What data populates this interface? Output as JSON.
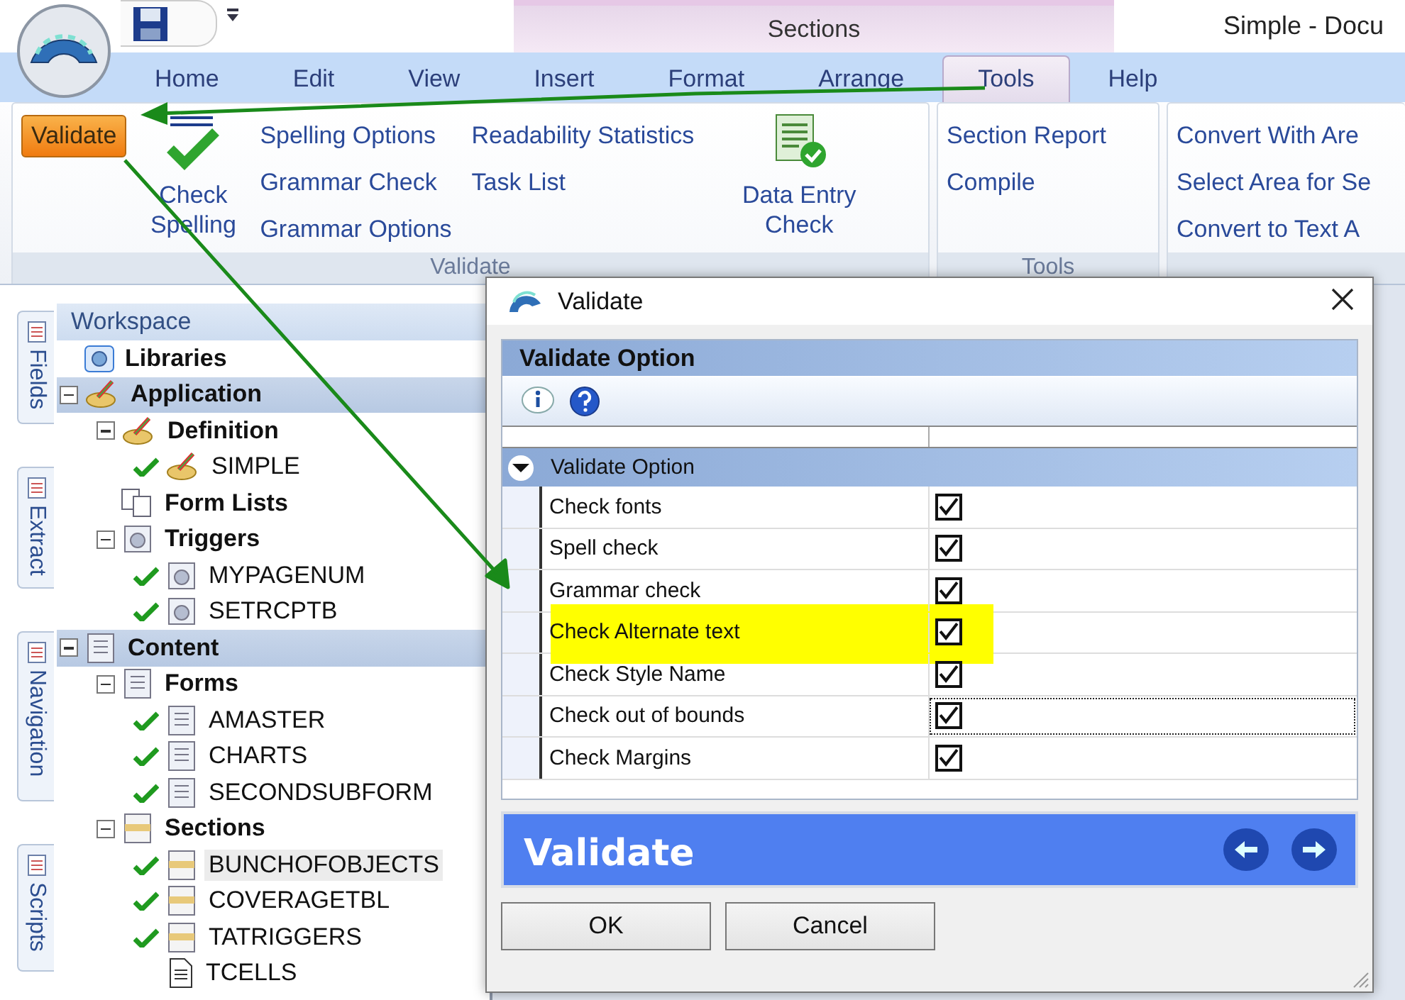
{
  "app": {
    "title": "Simple - Docu",
    "context_group": "Sections"
  },
  "ribbon_tabs": [
    {
      "label": "Home",
      "selected": false
    },
    {
      "label": "Edit",
      "selected": false
    },
    {
      "label": "View",
      "selected": false
    },
    {
      "label": "Insert",
      "selected": false
    },
    {
      "label": "Format",
      "selected": false
    },
    {
      "label": "Arrange",
      "selected": false
    },
    {
      "label": "Tools",
      "selected": true
    },
    {
      "label": "Help",
      "selected": false
    }
  ],
  "ribbon": {
    "validate_group": {
      "label": "Validate",
      "validate_button": {
        "label": "Validate",
        "highlighted": true
      },
      "check_spelling": "Check Spelling",
      "column_1": [
        "Spelling Options",
        "Grammar Check",
        "Grammar Options"
      ],
      "column_2": [
        "Readability Statistics",
        "Task List"
      ],
      "data_entry_check": "Data Entry Check"
    },
    "tools_group": {
      "label": "Tools",
      "items": [
        "Section Report",
        "Compile"
      ]
    },
    "group_3": {
      "items": [
        "Convert With Are",
        "Select Area for Se",
        "Convert to Text A"
      ]
    }
  },
  "side_tabs": [
    {
      "label": "Fields"
    },
    {
      "label": "Extract"
    },
    {
      "label": "Navigation"
    },
    {
      "label": "Scripts"
    }
  ],
  "workspace": {
    "title": "Workspace",
    "tree": [
      {
        "label": "Libraries",
        "kind": "library",
        "selected": false
      },
      {
        "label": "Application",
        "kind": "application",
        "selected": false,
        "expanded": true,
        "children": [
          {
            "label": "Definition",
            "kind": "definition",
            "selected": false,
            "expanded": true,
            "children": [
              {
                "label": "SIMPLE",
                "kind": "definition",
                "selected": false,
                "valid": true
              }
            ]
          },
          {
            "label": "Form Lists",
            "kind": "formlist",
            "selected": false
          },
          {
            "label": "Triggers",
            "kind": "trigger",
            "selected": false,
            "expanded": true,
            "children": [
              {
                "label": "MYPAGENUM",
                "kind": "trigger",
                "selected": false,
                "valid": true
              },
              {
                "label": "SETRCPTB",
                "kind": "trigger",
                "selected": false,
                "valid": true
              }
            ]
          }
        ]
      },
      {
        "label": "Content",
        "kind": "form",
        "selected": false,
        "expanded": true,
        "children": [
          {
            "label": "Forms",
            "kind": "form",
            "selected": false,
            "expanded": true,
            "children": [
              {
                "label": "AMASTER",
                "kind": "form",
                "selected": false,
                "valid": true
              },
              {
                "label": "CHARTS",
                "kind": "form",
                "selected": false,
                "valid": true
              },
              {
                "label": "SECONDSUBFORM",
                "kind": "form",
                "selected": false,
                "valid": true
              }
            ]
          },
          {
            "label": "Sections",
            "kind": "section",
            "selected": false,
            "expanded": true,
            "children": [
              {
                "label": "BUNCHOFOBJECTS",
                "kind": "section",
                "selected": true,
                "valid": true
              },
              {
                "label": "COVERAGETBL",
                "kind": "section",
                "selected": false,
                "valid": true
              },
              {
                "label": "TATRIGGERS",
                "kind": "section",
                "selected": false,
                "valid": true
              },
              {
                "label": "TCELLS",
                "kind": "document",
                "selected": false,
                "valid": false
              }
            ]
          }
        ]
      }
    ]
  },
  "dialog": {
    "title": "Validate",
    "header": "Validate Option",
    "category": {
      "label": "Validate Option",
      "expanded": true
    },
    "options": [
      {
        "label": "Check fonts",
        "checked": true,
        "highlighted": false,
        "focused": false
      },
      {
        "label": "Spell check",
        "checked": true,
        "highlighted": false,
        "focused": false
      },
      {
        "label": "Grammar check",
        "checked": true,
        "highlighted": false,
        "focused": false
      },
      {
        "label": "Check Alternate text",
        "checked": true,
        "highlighted": true,
        "focused": false
      },
      {
        "label": "Check Style Name",
        "checked": true,
        "highlighted": false,
        "focused": false
      },
      {
        "label": "Check out of bounds",
        "checked": true,
        "highlighted": false,
        "focused": true
      },
      {
        "label": "Check Margins",
        "checked": true,
        "highlighted": false,
        "focused": false
      }
    ],
    "banner": "Validate",
    "buttons": [
      "OK",
      "Cancel"
    ]
  }
}
